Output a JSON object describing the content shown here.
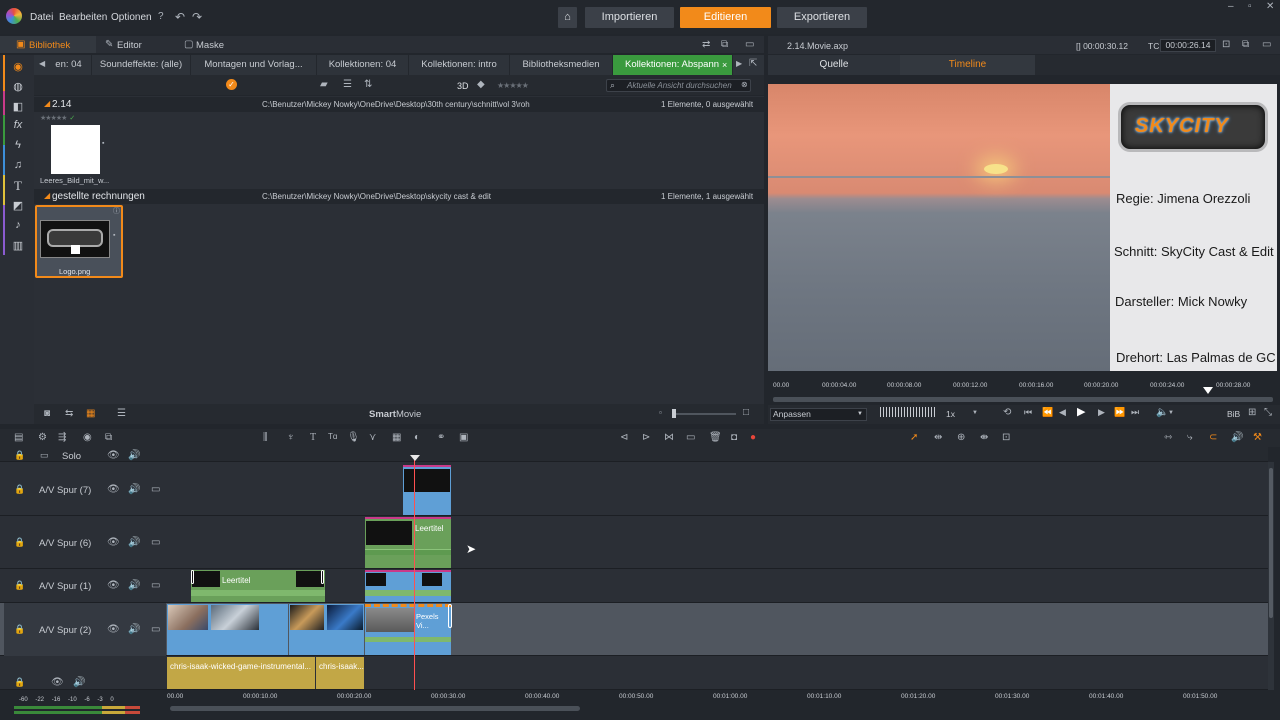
{
  "menu": {
    "file": "Datei",
    "edit": "Bearbeiten",
    "options": "Optionen"
  },
  "nav": {
    "import": "Importieren",
    "edit": "Editieren",
    "export": "Exportieren"
  },
  "left_tabs": {
    "library": "Bibliothek",
    "editor": "Editor",
    "mask": "Maske"
  },
  "collection_tabs": [
    "en: 04",
    "Soundeffekte: (alle)",
    "Montagen und Vorlag...",
    "Kollektionen: 04",
    "Kollektionen: intro",
    "Bibliotheksmedien",
    "Kollektionen: Abspann"
  ],
  "library_toolbar": {
    "three_d": "3D",
    "search_placeholder": "Aktuelle Ansicht durchsuchen"
  },
  "folders": [
    {
      "name": "2.14",
      "path": "C:\\Benutzer\\Mickey Nowky\\OneDrive\\Desktop\\30th century\\schnitt\\vol 3\\roh",
      "count": "1 Elemente, 0 ausgewählt",
      "item": "Leeres_Bild_mit_w..."
    },
    {
      "name": "gestellte rechnungen",
      "path": "C:\\Benutzer\\Mickey Nowky\\OneDrive\\Desktop\\skycity cast & edit",
      "count": "1 Elemente, 1 ausgewählt",
      "item": "Logo.png"
    }
  ],
  "smartmovie": {
    "smart": "Smart",
    "movie": "Movie"
  },
  "preview": {
    "title": "2.14.Movie.axp",
    "timecode_label": "TC",
    "duration": "[] 00:00:30.12",
    "timecode": "00:00:26.14",
    "tab_source": "Quelle",
    "tab_timeline": "Timeline",
    "logo_text": "SKYCITY",
    "credits": [
      "Regie: Jimena Orezzoli",
      "Schnitt: SkyCity Cast & Edit",
      "Darsteller: Mick Nowky",
      "Drehort: Las Palmas de GC"
    ],
    "ruler": [
      "00.00",
      "00:00:04.00",
      "00:00:08.00",
      "00:00:12.00",
      "00:00:16.00",
      "00:00:20.00",
      "00:00:24.00",
      "00:00:28.00"
    ],
    "fit": "Anpassen",
    "speed": "1x",
    "bib": "BiB"
  },
  "tracks": [
    {
      "name": "Solo"
    },
    {
      "name": "A/V Spur (7)"
    },
    {
      "name": "A/V Spur (6)"
    },
    {
      "name": "A/V Spur (1)"
    },
    {
      "name": "A/V Spur (2)"
    }
  ],
  "clips": {
    "title1": "Leertitel",
    "title2": "Leertitel",
    "pexels": "Pexels Vi...",
    "audio1": "chris-isaak-wicked-game-instrumental...",
    "audio2": "chris-isaak..."
  },
  "timeline_ruler": [
    "00.00",
    "00:00:10.00",
    "00:00:20.00",
    "00:00:30.00",
    "00:00:40.00",
    "00:00:50.00",
    "00:01:00.00",
    "00:01:10.00",
    "00:01:20.00",
    "00:01:30.00",
    "00:01:40.00",
    "00:01:50.00"
  ],
  "meter_labels": [
    "-60",
    "-22",
    "-16",
    "-10",
    "-6",
    "-3",
    "0"
  ]
}
